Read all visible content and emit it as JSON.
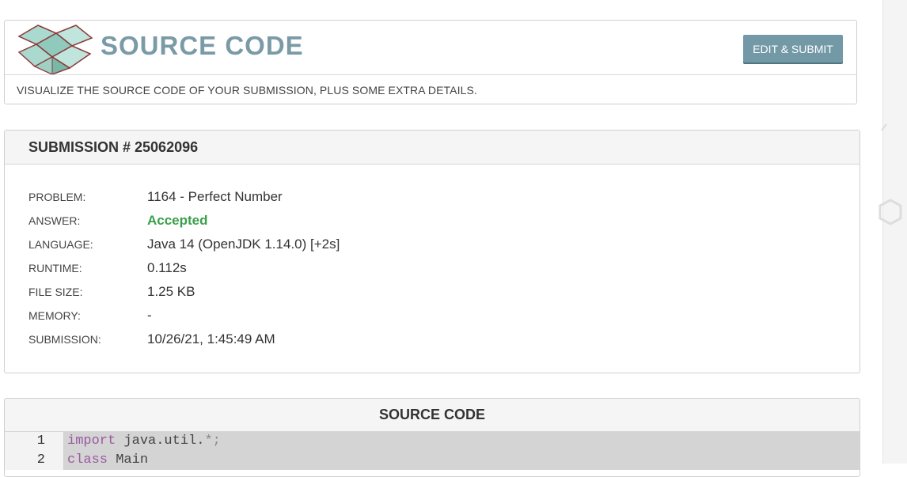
{
  "header": {
    "title": "SOURCE CODE",
    "edit_button_label": "EDIT & SUBMIT",
    "description": "VISUALIZE THE SOURCE CODE OF YOUR SUBMISSION, PLUS SOME EXTRA DETAILS."
  },
  "submission": {
    "title": "SUBMISSION # 25062096",
    "details": [
      {
        "label": "PROBLEM:",
        "value": "1164 - Perfect Number"
      },
      {
        "label": "ANSWER:",
        "value": "Accepted"
      },
      {
        "label": "LANGUAGE:",
        "value": "Java 14 (OpenJDK 1.14.0) [+2s]"
      },
      {
        "label": "RUNTIME:",
        "value": "0.112s"
      },
      {
        "label": "FILE SIZE:",
        "value": "1.25 KB"
      },
      {
        "label": "MEMORY:",
        "value": "-"
      },
      {
        "label": "SUBMISSION:",
        "value": "10/26/21, 1:45:49 AM"
      }
    ]
  },
  "source_code": {
    "title": "SOURCE CODE",
    "lines": [
      {
        "number": "1",
        "keyword": "import",
        "rest": " java.util.",
        "punct": "*;"
      },
      {
        "number": "2",
        "keyword": "class",
        "rest": " Main",
        "punct": ""
      }
    ]
  },
  "colors": {
    "title": "#7a9aa6",
    "button": "#7399a6",
    "accepted": "#3aa04b",
    "keyword": "#9a5aa0"
  },
  "icons": [
    "box-icon"
  ]
}
